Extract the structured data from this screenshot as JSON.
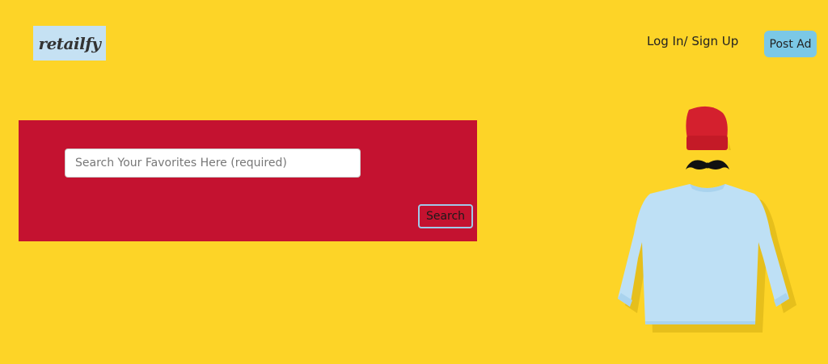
{
  "header": {
    "logo_text": "retailfy",
    "login_label": "Log In/ Sign Up",
    "post_ad_label": "Post Ad"
  },
  "search": {
    "placeholder": "Search Your Favorites Here (required)",
    "value": "",
    "button_label": "Search"
  },
  "hero": {
    "image": "clothing-illustration",
    "items": [
      "red-beanie-icon",
      "mustache-icon",
      "light-blue-sweater-icon"
    ]
  },
  "colors": {
    "background": "#FDD427",
    "search_panel": "#C41230",
    "post_ad_button": "#7BC8E6",
    "logo_background": "#C5E1F3",
    "beanie": "#D4202E",
    "sweater": "#BEE0F5"
  }
}
